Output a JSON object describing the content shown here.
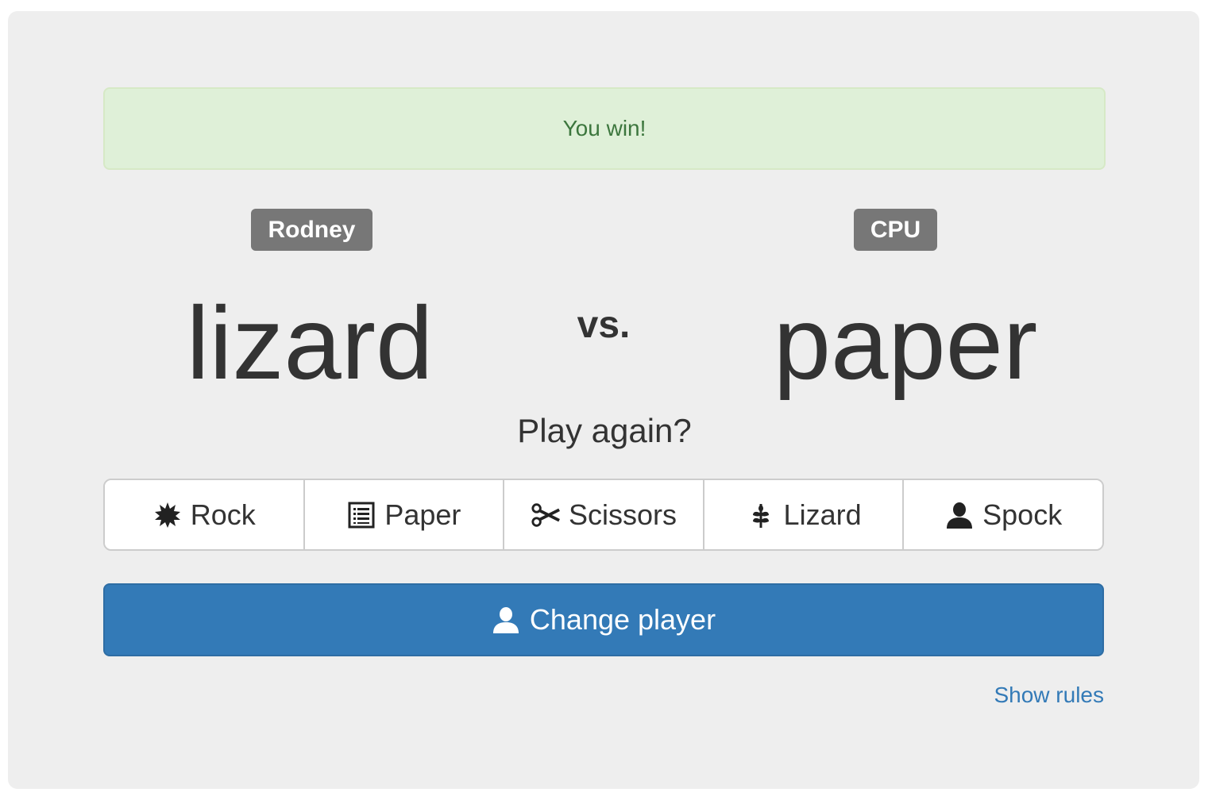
{
  "result": {
    "message": "You win!"
  },
  "players": {
    "player": {
      "name": "Rodney",
      "choice": "lizard"
    },
    "cpu": {
      "name": "CPU",
      "choice": "paper"
    },
    "vs_label": "vs."
  },
  "prompt": {
    "play_again": "Play again?"
  },
  "choices": [
    {
      "label": "Rock",
      "icon": "asterisk-burst-icon"
    },
    {
      "label": "Paper",
      "icon": "list-document-icon"
    },
    {
      "label": "Scissors",
      "icon": "scissors-icon"
    },
    {
      "label": "Lizard",
      "icon": "leaf-icon"
    },
    {
      "label": "Spock",
      "icon": "user-icon"
    }
  ],
  "actions": {
    "change_player_label": "Change player",
    "show_rules_label": "Show rules"
  },
  "colors": {
    "panel_bg": "#eeeeee",
    "success_bg": "#dff0d8",
    "success_text": "#3c763d",
    "badge_bg": "#777777",
    "primary": "#337ab7"
  }
}
